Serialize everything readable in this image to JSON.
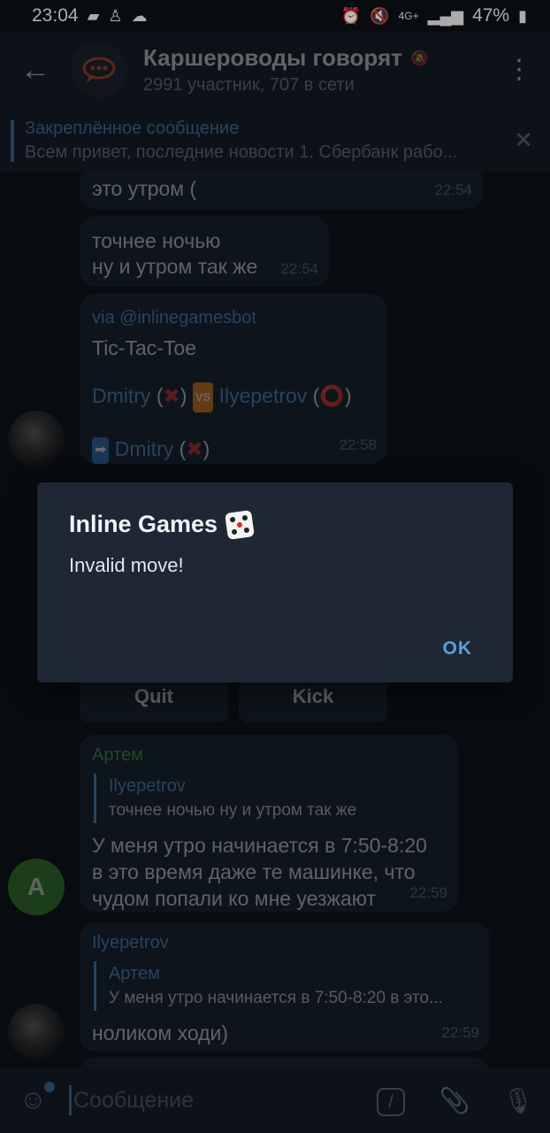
{
  "status_bar": {
    "time": "23:04",
    "network": "4G+",
    "battery": "47%"
  },
  "header": {
    "title": "Каршероводы говорят",
    "subtitle": "2991 участник, 707 в сети"
  },
  "pinned": {
    "title": "Закреплённое сообщение",
    "text": "Всем привет, последние новости  1. Сбербанк рабо..."
  },
  "messages": [
    {
      "text": "это утром (",
      "time": "22:54"
    },
    {
      "line1": "точнее ночью",
      "line2": "ну и утром так же",
      "time": "22:54"
    },
    {
      "via_prefix": "via ",
      "via_bot": "@inlinegamesbot",
      "game_title": "Tic-Tac-Toe",
      "player1": "Dmitry",
      "vs": "VS",
      "player2": "Ilyepetrov",
      "turn_player": "Dmitry",
      "time": "22:58"
    },
    {
      "author": "Артем",
      "reply_author": "Ilyepetrov",
      "reply_text": "точнее ночью ну и утром так же",
      "line1": "У меня утро начинается в 7:50-8:20",
      "line2": "в это время даже те машинке, что",
      "line3": "чудом попали ко мне уезжают",
      "time": "22:59"
    },
    {
      "author": "Ilyepetrov",
      "reply_author": "Артем",
      "reply_text": "У меня утро начинается в 7:50-8:20 в это...",
      "text": "ноликом ходи)",
      "time": "22:59"
    }
  ],
  "keyboard": {
    "quit": "Quit",
    "kick": "Kick"
  },
  "avatar_letter": "А",
  "dialog": {
    "title": "Inline Games",
    "message": "Invalid move!",
    "ok": "OK"
  },
  "input": {
    "placeholder": "Сообщение"
  },
  "colors": {
    "accent": "#58a1de",
    "bubble": "#1c2633",
    "header": "#1a222c",
    "author_green": "#4caf50",
    "mark_red": "#e03a3a"
  }
}
